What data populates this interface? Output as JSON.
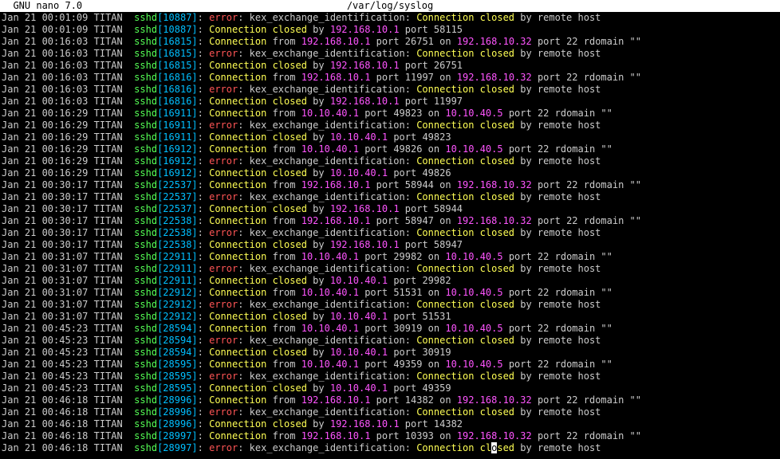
{
  "title": {
    "left": "  GNU nano 7.0",
    "center": "/var/log/syslog"
  },
  "columns": {
    "hostname": "TITAN",
    "process": "sshd"
  },
  "tokens": {
    "error": "error",
    "kex": "kex_exchange_identification",
    "conn": "Connection",
    "connclosed": "Connection closed",
    "from": "from",
    "by": "by",
    "on": "on",
    "port": "port",
    "remote": "remote host",
    "rdomain": "rdomain",
    "r22": "22"
  },
  "lines": [
    {
      "ts": "Jan 21 00:01:09",
      "pid": "10887",
      "type": "err"
    },
    {
      "ts": "Jan 21 00:01:09",
      "pid": "10887",
      "type": "closed",
      "ip": "192.168.10.1",
      "port": "58115"
    },
    {
      "ts": "Jan 21 00:16:03",
      "pid": "16815",
      "type": "conn",
      "ip": "192.168.10.1",
      "port": "26751",
      "ip2": "192.168.10.32"
    },
    {
      "ts": "Jan 21 00:16:03",
      "pid": "16815",
      "type": "err"
    },
    {
      "ts": "Jan 21 00:16:03",
      "pid": "16815",
      "type": "closed",
      "ip": "192.168.10.1",
      "port": "26751"
    },
    {
      "ts": "Jan 21 00:16:03",
      "pid": "16816",
      "type": "conn",
      "ip": "192.168.10.1",
      "port": "11997",
      "ip2": "192.168.10.32"
    },
    {
      "ts": "Jan 21 00:16:03",
      "pid": "16816",
      "type": "err"
    },
    {
      "ts": "Jan 21 00:16:03",
      "pid": "16816",
      "type": "closed",
      "ip": "192.168.10.1",
      "port": "11997"
    },
    {
      "ts": "Jan 21 00:16:29",
      "pid": "16911",
      "type": "conn",
      "ip": "10.10.40.1",
      "port": "49823",
      "ip2": "10.10.40.5"
    },
    {
      "ts": "Jan 21 00:16:29",
      "pid": "16911",
      "type": "err"
    },
    {
      "ts": "Jan 21 00:16:29",
      "pid": "16911",
      "type": "closed",
      "ip": "10.10.40.1",
      "port": "49823"
    },
    {
      "ts": "Jan 21 00:16:29",
      "pid": "16912",
      "type": "conn",
      "ip": "10.10.40.1",
      "port": "49826",
      "ip2": "10.10.40.5"
    },
    {
      "ts": "Jan 21 00:16:29",
      "pid": "16912",
      "type": "err"
    },
    {
      "ts": "Jan 21 00:16:29",
      "pid": "16912",
      "type": "closed",
      "ip": "10.10.40.1",
      "port": "49826"
    },
    {
      "ts": "Jan 21 00:30:17",
      "pid": "22537",
      "type": "conn",
      "ip": "192.168.10.1",
      "port": "58944",
      "ip2": "192.168.10.32"
    },
    {
      "ts": "Jan 21 00:30:17",
      "pid": "22537",
      "type": "err"
    },
    {
      "ts": "Jan 21 00:30:17",
      "pid": "22537",
      "type": "closed",
      "ip": "192.168.10.1",
      "port": "58944"
    },
    {
      "ts": "Jan 21 00:30:17",
      "pid": "22538",
      "type": "conn",
      "ip": "192.168.10.1",
      "port": "58947",
      "ip2": "192.168.10.32"
    },
    {
      "ts": "Jan 21 00:30:17",
      "pid": "22538",
      "type": "err"
    },
    {
      "ts": "Jan 21 00:30:17",
      "pid": "22538",
      "type": "closed",
      "ip": "192.168.10.1",
      "port": "58947"
    },
    {
      "ts": "Jan 21 00:31:07",
      "pid": "22911",
      "type": "conn",
      "ip": "10.10.40.1",
      "port": "29982",
      "ip2": "10.10.40.5"
    },
    {
      "ts": "Jan 21 00:31:07",
      "pid": "22911",
      "type": "err"
    },
    {
      "ts": "Jan 21 00:31:07",
      "pid": "22911",
      "type": "closed",
      "ip": "10.10.40.1",
      "port": "29982"
    },
    {
      "ts": "Jan 21 00:31:07",
      "pid": "22912",
      "type": "conn",
      "ip": "10.10.40.1",
      "port": "51531",
      "ip2": "10.10.40.5"
    },
    {
      "ts": "Jan 21 00:31:07",
      "pid": "22912",
      "type": "err"
    },
    {
      "ts": "Jan 21 00:31:07",
      "pid": "22912",
      "type": "closed",
      "ip": "10.10.40.1",
      "port": "51531"
    },
    {
      "ts": "Jan 21 00:45:23",
      "pid": "28594",
      "type": "conn",
      "ip": "10.10.40.1",
      "port": "30919",
      "ip2": "10.10.40.5"
    },
    {
      "ts": "Jan 21 00:45:23",
      "pid": "28594",
      "type": "err"
    },
    {
      "ts": "Jan 21 00:45:23",
      "pid": "28594",
      "type": "closed",
      "ip": "10.10.40.1",
      "port": "30919"
    },
    {
      "ts": "Jan 21 00:45:23",
      "pid": "28595",
      "type": "conn",
      "ip": "10.10.40.1",
      "port": "49359",
      "ip2": "10.10.40.5"
    },
    {
      "ts": "Jan 21 00:45:23",
      "pid": "28595",
      "type": "err"
    },
    {
      "ts": "Jan 21 00:45:23",
      "pid": "28595",
      "type": "closed",
      "ip": "10.10.40.1",
      "port": "49359"
    },
    {
      "ts": "Jan 21 00:46:18",
      "pid": "28996",
      "type": "conn",
      "ip": "192.168.10.1",
      "port": "14382",
      "ip2": "192.168.10.32"
    },
    {
      "ts": "Jan 21 00:46:18",
      "pid": "28996",
      "type": "err"
    },
    {
      "ts": "Jan 21 00:46:18",
      "pid": "28996",
      "type": "closed",
      "ip": "192.168.10.1",
      "port": "14382"
    },
    {
      "ts": "Jan 21 00:46:18",
      "pid": "28997",
      "type": "conn",
      "ip": "192.168.10.1",
      "port": "10393",
      "ip2": "192.168.10.32"
    },
    {
      "ts": "Jan 21 00:46:18",
      "pid": "28997",
      "type": "err",
      "cursor": true
    }
  ],
  "colors": {
    "bg": "#000000",
    "fg": "#ffffff",
    "dim": "#cccccc",
    "proc": "#55ff55",
    "pid": "#00bfff",
    "err": "#ff5555",
    "conn": "#ffff55",
    "ip": "#ff55ff"
  }
}
